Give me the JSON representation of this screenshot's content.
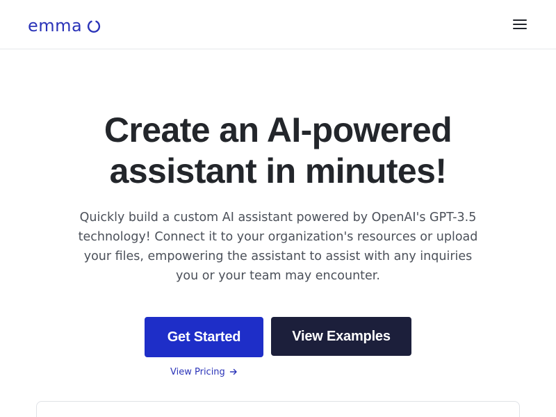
{
  "brand": {
    "name": "emma",
    "logo_icon": "ring-icon",
    "accent_color": "#2a33b8"
  },
  "nav": {
    "menu_icon": "hamburger-menu-icon"
  },
  "hero": {
    "title": "Create an AI-powered assistant in minutes!",
    "description": "Quickly build a custom AI assistant powered by OpenAI's GPT-3.5 technology! Connect it to your organization's resources or upload your files, empowering the assistant to assist with any inquiries you or your team may encounter."
  },
  "actions": {
    "get_started_label": "Get Started",
    "get_started_color": "#1e2ec8",
    "view_examples_label": "View Examples",
    "view_examples_color": "#1c1f3b",
    "view_pricing_label": "View Pricing",
    "view_pricing_icon": "arrow-right-icon"
  }
}
